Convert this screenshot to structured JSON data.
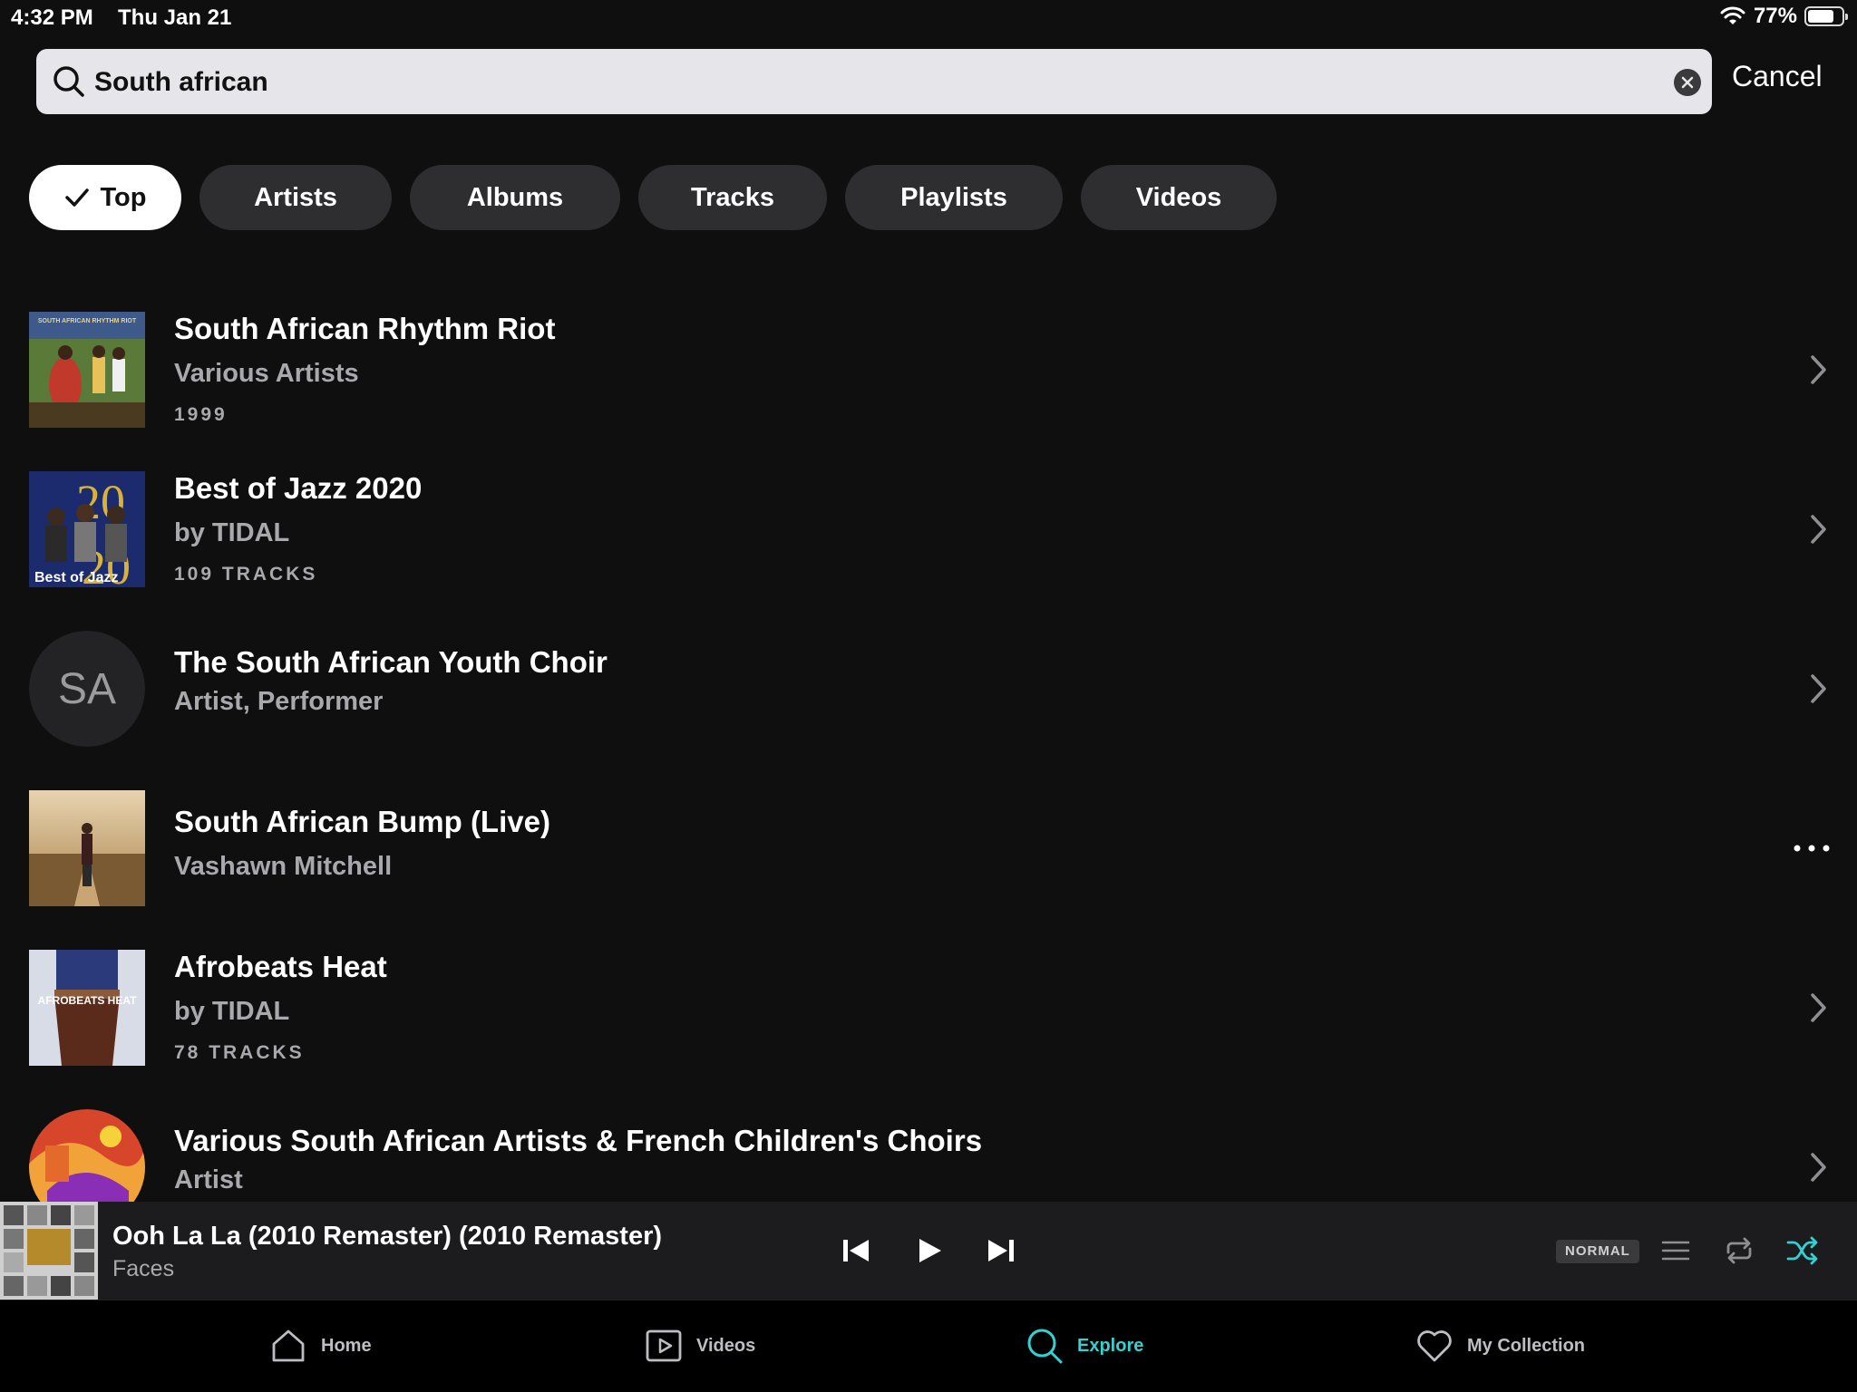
{
  "status_bar": {
    "time": "4:32 PM",
    "date": "Thu Jan 21",
    "battery_percent": "77%",
    "battery_level": 0.77
  },
  "search": {
    "query": "South african",
    "cancel_label": "Cancel"
  },
  "filters": [
    {
      "label": "Top",
      "active": true
    },
    {
      "label": "Artists",
      "active": false
    },
    {
      "label": "Albums",
      "active": false
    },
    {
      "label": "Tracks",
      "active": false
    },
    {
      "label": "Playlists",
      "active": false
    },
    {
      "label": "Videos",
      "active": false
    }
  ],
  "results": [
    {
      "title": "South African Rhythm Riot",
      "subtitle": "Various Artists",
      "meta": "1999",
      "action": "chevron-right-icon",
      "art_text": "SOUTH AFRICAN RHYTHM RIOT"
    },
    {
      "title": "Best of Jazz 2020",
      "subtitle": "by TIDAL",
      "meta": "109 TRACKS",
      "action": "chevron-right-icon",
      "art_text": "Best of Jazz"
    },
    {
      "title": "The South African Youth Choir",
      "subtitle": "Artist, Performer",
      "meta": "",
      "action": "chevron-right-icon",
      "initials": "SA"
    },
    {
      "title": "South African Bump (Live)",
      "subtitle": "Vashawn Mitchell",
      "meta": "",
      "action": "more-icon"
    },
    {
      "title": "Afrobeats Heat",
      "subtitle": "by TIDAL",
      "meta": "78 TRACKS",
      "action": "chevron-right-icon",
      "art_text": "AFROBEATS HEAT"
    },
    {
      "title": "Various South African Artists & French Children's Choirs",
      "subtitle": "Artist",
      "meta": "",
      "action": "chevron-right-icon"
    }
  ],
  "player": {
    "title": "Ooh La La (2010 Remaster) (2010 Remaster)",
    "artist": "Faces",
    "quality": "NORMAL",
    "shuffle_active": true
  },
  "tabs": [
    {
      "label": "Home",
      "icon": "home-icon",
      "active": false
    },
    {
      "label": "Videos",
      "icon": "video-icon",
      "active": false
    },
    {
      "label": "Explore",
      "icon": "search-icon",
      "active": true
    },
    {
      "label": "My Collection",
      "icon": "heart-icon",
      "active": false
    }
  ],
  "colors": {
    "background": "#0f0f10",
    "accent": "#33d1d1",
    "chip": "#2e2e31",
    "secondary_text": "#a8a8ad"
  }
}
